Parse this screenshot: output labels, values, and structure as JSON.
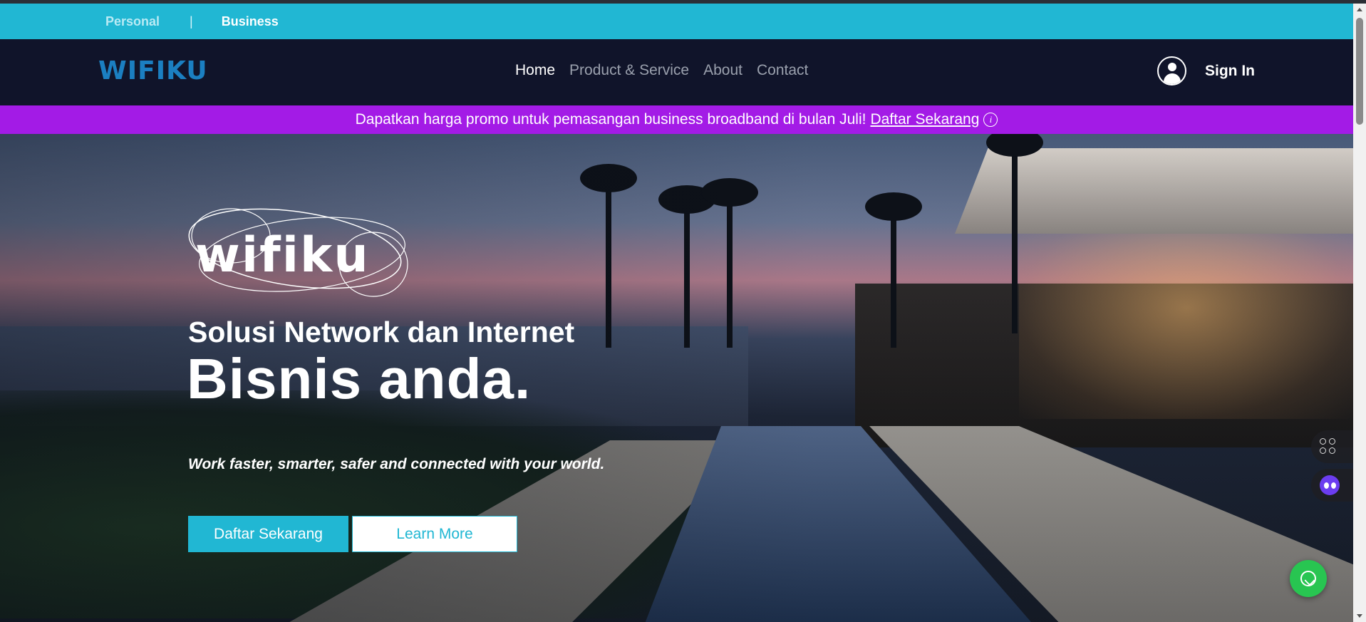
{
  "segment_bar": {
    "personal_label": "Personal",
    "divider": "|",
    "business_label": "Business"
  },
  "navbar": {
    "logo_text": "WIFIKU",
    "links": [
      "Home",
      "Product & Service",
      "About",
      "Contact"
    ],
    "active_link": "Home",
    "sign_in_label": "Sign In"
  },
  "promo": {
    "text": "Dapatkan harga promo untuk pemasangan business broadband di bulan Juli!",
    "link_label": "Daftar Sekarang",
    "info_icon": "i"
  },
  "hero": {
    "logo_wordmark": "wifiku",
    "subtitle": "Solusi Network dan Internet",
    "title": "Bisnis anda.",
    "tagline": "Work faster, smarter, safer and connected with your world.",
    "primary_button": "Daftar Sekarang",
    "secondary_button": "Learn More"
  },
  "colors": {
    "accent_cyan": "#21b7d3",
    "navbar_bg": "#10142a",
    "promo_bg": "#a31be6",
    "whatsapp_green": "#28c551",
    "logo_blue": "#1b7fc1"
  },
  "icons": {
    "user": "user-circle-icon",
    "info": "info-circle-icon",
    "apps": "apps-grid-icon",
    "bot": "chat-bot-icon",
    "whatsapp": "whatsapp-icon"
  }
}
